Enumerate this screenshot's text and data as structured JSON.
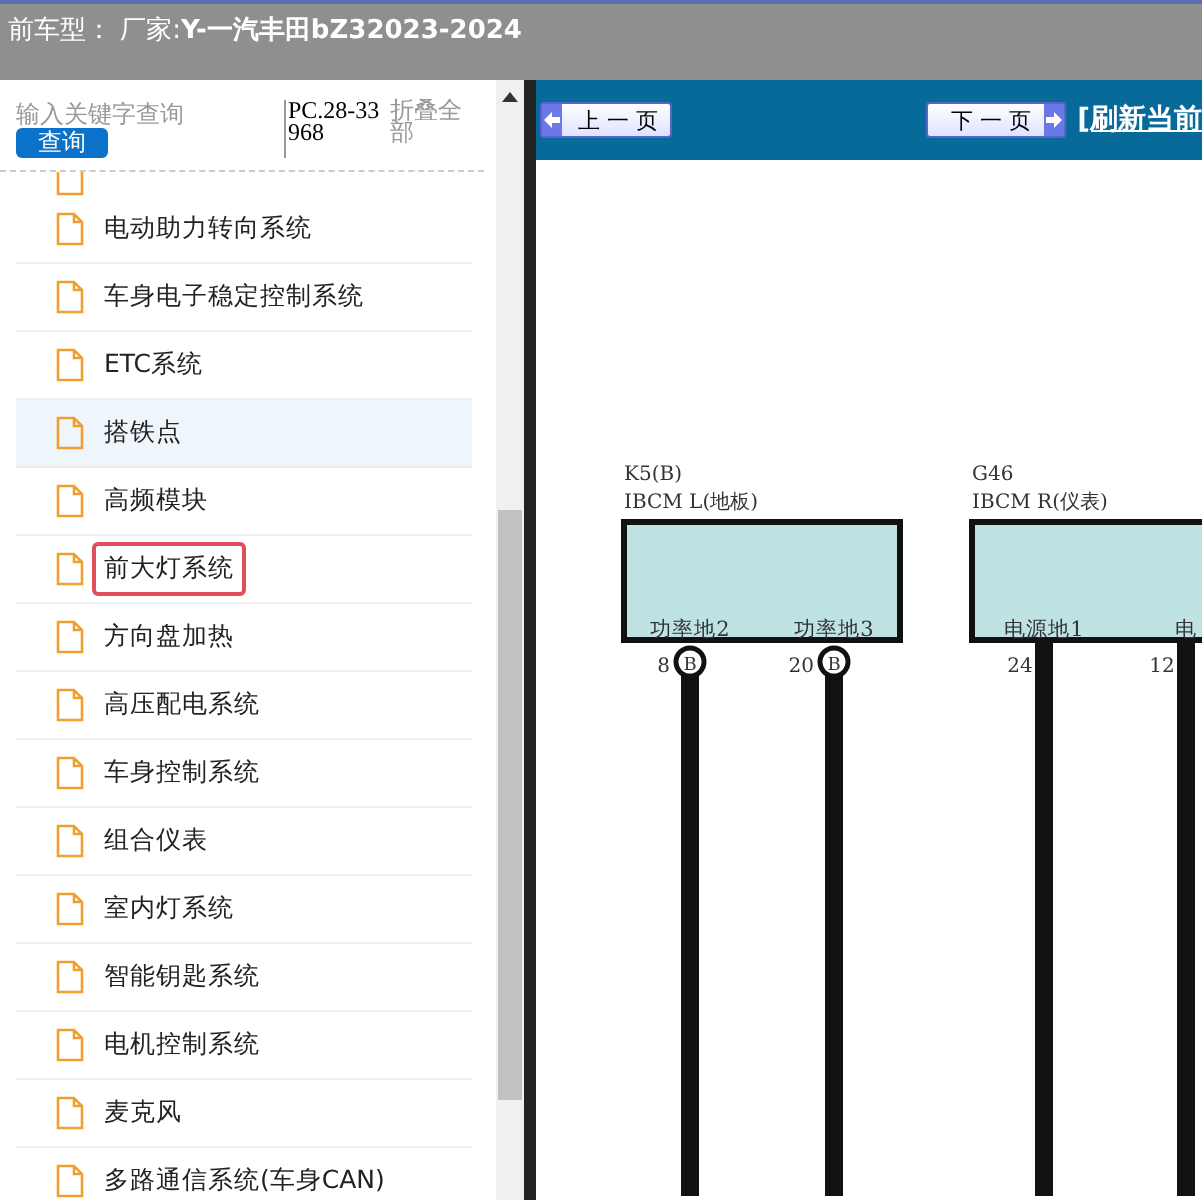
{
  "window_title": "前车型：  厂家:**Y-一汽丰田bZ32023-2024**",
  "sidebar": {
    "search": {
      "placeholder": "输入关键字查询"
    },
    "search_button": "查询",
    "code": "PC.28-33968",
    "collapse": "折叠全部",
    "items": [
      {
        "label": "电动助力转向系统",
        "selected": false,
        "marked": false
      },
      {
        "label": "车身电子稳定控制系统",
        "selected": false,
        "marked": false
      },
      {
        "label": "ETC系统",
        "selected": false,
        "marked": false
      },
      {
        "label": "搭铁点",
        "selected": true,
        "marked": false
      },
      {
        "label": "高频模块",
        "selected": false,
        "marked": false
      },
      {
        "label": "前大灯系统",
        "selected": false,
        "marked": true
      },
      {
        "label": "方向盘加热",
        "selected": false,
        "marked": false
      },
      {
        "label": "高压配电系统",
        "selected": false,
        "marked": false
      },
      {
        "label": "车身控制系统",
        "selected": false,
        "marked": false
      },
      {
        "label": "组合仪表",
        "selected": false,
        "marked": false
      },
      {
        "label": "室内灯系统",
        "selected": false,
        "marked": false
      },
      {
        "label": "智能钥匙系统",
        "selected": false,
        "marked": false
      },
      {
        "label": "电机控制系统",
        "selected": false,
        "marked": false
      },
      {
        "label": "麦克风",
        "selected": false,
        "marked": false
      },
      {
        "label": "多路通信系统(车身CAN)",
        "selected": false,
        "marked": false
      }
    ]
  },
  "toolbar": {
    "prev": "上 一 页",
    "next": "下 一 页",
    "refresh": "[刷新当前"
  },
  "diagram": {
    "modules": [
      {
        "code": "K5(B)",
        "name": "IBCM L(地板)",
        "pins": [
          {
            "label": "功率地2",
            "number": "8",
            "terminal": "B"
          },
          {
            "label": "功率地3",
            "number": "20",
            "terminal": "B"
          }
        ]
      },
      {
        "code": "G46",
        "name": "IBCM R(仪表)",
        "pins": [
          {
            "label": "电源地1",
            "number": "24"
          },
          {
            "label": "电",
            "number": "12"
          }
        ]
      }
    ]
  }
}
